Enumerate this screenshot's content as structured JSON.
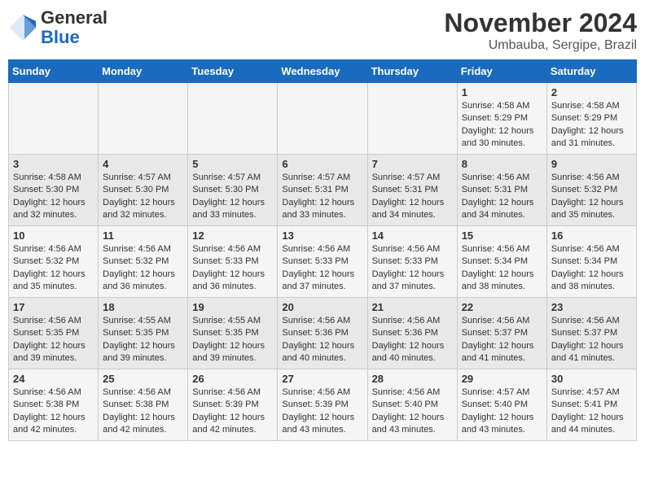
{
  "header": {
    "logo_line1": "General",
    "logo_line2": "Blue",
    "month": "November 2024",
    "location": "Umbauba, Sergipe, Brazil"
  },
  "days_of_week": [
    "Sunday",
    "Monday",
    "Tuesday",
    "Wednesday",
    "Thursday",
    "Friday",
    "Saturday"
  ],
  "weeks": [
    [
      {
        "day": "",
        "info": ""
      },
      {
        "day": "",
        "info": ""
      },
      {
        "day": "",
        "info": ""
      },
      {
        "day": "",
        "info": ""
      },
      {
        "day": "",
        "info": ""
      },
      {
        "day": "1",
        "info": "Sunrise: 4:58 AM\nSunset: 5:29 PM\nDaylight: 12 hours and 30 minutes."
      },
      {
        "day": "2",
        "info": "Sunrise: 4:58 AM\nSunset: 5:29 PM\nDaylight: 12 hours and 31 minutes."
      }
    ],
    [
      {
        "day": "3",
        "info": "Sunrise: 4:58 AM\nSunset: 5:30 PM\nDaylight: 12 hours and 32 minutes."
      },
      {
        "day": "4",
        "info": "Sunrise: 4:57 AM\nSunset: 5:30 PM\nDaylight: 12 hours and 32 minutes."
      },
      {
        "day": "5",
        "info": "Sunrise: 4:57 AM\nSunset: 5:30 PM\nDaylight: 12 hours and 33 minutes."
      },
      {
        "day": "6",
        "info": "Sunrise: 4:57 AM\nSunset: 5:31 PM\nDaylight: 12 hours and 33 minutes."
      },
      {
        "day": "7",
        "info": "Sunrise: 4:57 AM\nSunset: 5:31 PM\nDaylight: 12 hours and 34 minutes."
      },
      {
        "day": "8",
        "info": "Sunrise: 4:56 AM\nSunset: 5:31 PM\nDaylight: 12 hours and 34 minutes."
      },
      {
        "day": "9",
        "info": "Sunrise: 4:56 AM\nSunset: 5:32 PM\nDaylight: 12 hours and 35 minutes."
      }
    ],
    [
      {
        "day": "10",
        "info": "Sunrise: 4:56 AM\nSunset: 5:32 PM\nDaylight: 12 hours and 35 minutes."
      },
      {
        "day": "11",
        "info": "Sunrise: 4:56 AM\nSunset: 5:32 PM\nDaylight: 12 hours and 36 minutes."
      },
      {
        "day": "12",
        "info": "Sunrise: 4:56 AM\nSunset: 5:33 PM\nDaylight: 12 hours and 36 minutes."
      },
      {
        "day": "13",
        "info": "Sunrise: 4:56 AM\nSunset: 5:33 PM\nDaylight: 12 hours and 37 minutes."
      },
      {
        "day": "14",
        "info": "Sunrise: 4:56 AM\nSunset: 5:33 PM\nDaylight: 12 hours and 37 minutes."
      },
      {
        "day": "15",
        "info": "Sunrise: 4:56 AM\nSunset: 5:34 PM\nDaylight: 12 hours and 38 minutes."
      },
      {
        "day": "16",
        "info": "Sunrise: 4:56 AM\nSunset: 5:34 PM\nDaylight: 12 hours and 38 minutes."
      }
    ],
    [
      {
        "day": "17",
        "info": "Sunrise: 4:56 AM\nSunset: 5:35 PM\nDaylight: 12 hours and 39 minutes."
      },
      {
        "day": "18",
        "info": "Sunrise: 4:55 AM\nSunset: 5:35 PM\nDaylight: 12 hours and 39 minutes."
      },
      {
        "day": "19",
        "info": "Sunrise: 4:55 AM\nSunset: 5:35 PM\nDaylight: 12 hours and 39 minutes."
      },
      {
        "day": "20",
        "info": "Sunrise: 4:56 AM\nSunset: 5:36 PM\nDaylight: 12 hours and 40 minutes."
      },
      {
        "day": "21",
        "info": "Sunrise: 4:56 AM\nSunset: 5:36 PM\nDaylight: 12 hours and 40 minutes."
      },
      {
        "day": "22",
        "info": "Sunrise: 4:56 AM\nSunset: 5:37 PM\nDaylight: 12 hours and 41 minutes."
      },
      {
        "day": "23",
        "info": "Sunrise: 4:56 AM\nSunset: 5:37 PM\nDaylight: 12 hours and 41 minutes."
      }
    ],
    [
      {
        "day": "24",
        "info": "Sunrise: 4:56 AM\nSunset: 5:38 PM\nDaylight: 12 hours and 42 minutes."
      },
      {
        "day": "25",
        "info": "Sunrise: 4:56 AM\nSunset: 5:38 PM\nDaylight: 12 hours and 42 minutes."
      },
      {
        "day": "26",
        "info": "Sunrise: 4:56 AM\nSunset: 5:39 PM\nDaylight: 12 hours and 42 minutes."
      },
      {
        "day": "27",
        "info": "Sunrise: 4:56 AM\nSunset: 5:39 PM\nDaylight: 12 hours and 43 minutes."
      },
      {
        "day": "28",
        "info": "Sunrise: 4:56 AM\nSunset: 5:40 PM\nDaylight: 12 hours and 43 minutes."
      },
      {
        "day": "29",
        "info": "Sunrise: 4:57 AM\nSunset: 5:40 PM\nDaylight: 12 hours and 43 minutes."
      },
      {
        "day": "30",
        "info": "Sunrise: 4:57 AM\nSunset: 5:41 PM\nDaylight: 12 hours and 44 minutes."
      }
    ]
  ]
}
